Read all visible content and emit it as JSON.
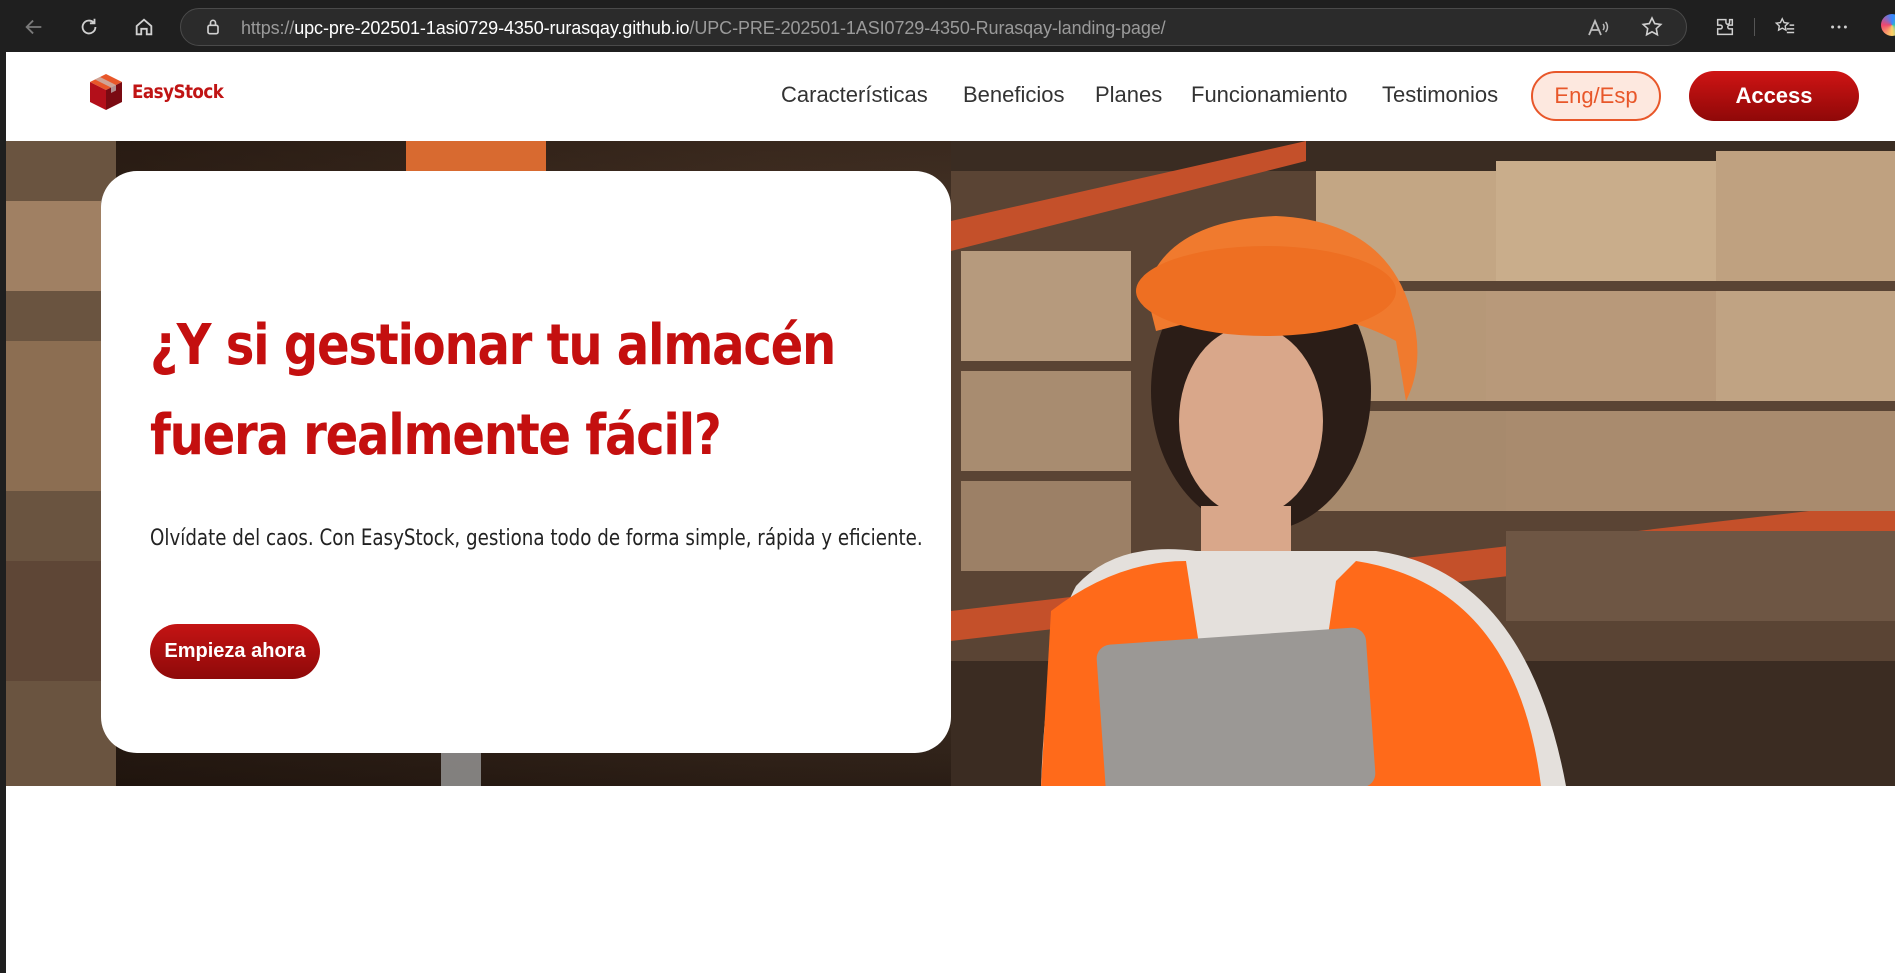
{
  "browser": {
    "url_protocol": "https://",
    "url_host": "upc-pre-202501-1asi0729-4350-rurasqay.github.io",
    "url_path": "/UPC-PRE-202501-1ASI0729-4350-Rurasqay-landing-page/"
  },
  "nav": {
    "logo_text": "EasyStock",
    "items": [
      "Características",
      "Beneficios",
      "Planes",
      "Funcionamiento",
      "Testimonios"
    ],
    "lang_label": "Eng/Esp",
    "access_label": "Access"
  },
  "hero": {
    "headline_line1": "¿Y si gestionar tu almacén",
    "headline_line2": "fuera realmente fácil?",
    "subtext": "Olvídate del caos. Con EasyStock, gestiona todo de forma simple, rápida y eficiente.",
    "cta_label": "Empieza ahora"
  },
  "colors": {
    "brand_red": "#c40f0f",
    "accent_orange": "#e8572a"
  }
}
